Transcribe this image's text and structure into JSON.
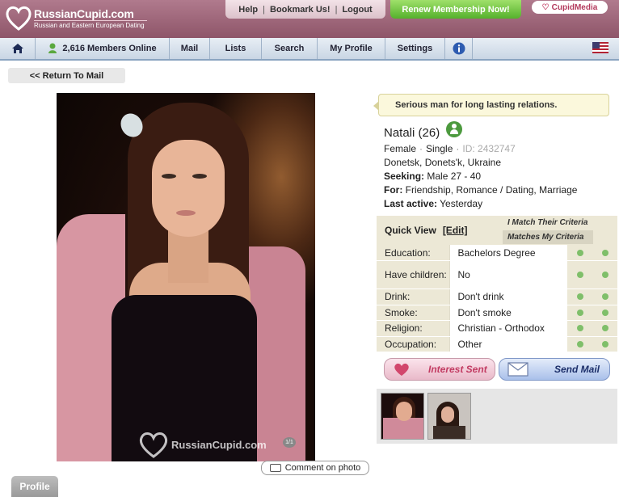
{
  "header": {
    "brand_name": "RussianCupid.com",
    "brand_tagline": "Russian and Eastern European Dating",
    "links": [
      "Help",
      "Bookmark Us!",
      "Logout"
    ],
    "renew_label": "Renew Membership Now!",
    "cupidmedia_label": "CupidMedia",
    "brand_color": "#9a6276",
    "renew_color": "#6cc03a"
  },
  "nav": {
    "members_online": "2,616 Members Online",
    "mail": "Mail",
    "lists": "Lists",
    "search": "Search",
    "my_profile": "My Profile",
    "settings": "Settings"
  },
  "return_label": "<< Return To Mail",
  "photo": {
    "watermark": "RussianCupid.com",
    "count": "1/1"
  },
  "comment_label": "Comment on photo",
  "profile_tab": "Profile",
  "profile": {
    "headline": "Serious man for long lasting relations.",
    "name": "Natali (26)",
    "gender": "Female",
    "status": "Single",
    "id": "ID: 2432747",
    "location": "Donetsk, Donets'k, Ukraine",
    "seeking_label": "Seeking:",
    "seeking": "Male 27 - 40",
    "for_label": "For:",
    "for": "Friendship, Romance / Dating, Marriage",
    "last_active_label": "Last active:",
    "last_active": "Yesterday"
  },
  "quick_view": {
    "title": "Quick View",
    "edit": "[Edit]",
    "criteria1": "I Match Their Criteria",
    "criteria2": "Matches My Criteria",
    "rows": [
      {
        "label": "Education:",
        "value": "Bachelors Degree"
      },
      {
        "label": "Have children:",
        "value": "No"
      },
      {
        "label": "Drink:",
        "value": "Don't drink"
      },
      {
        "label": "Smoke:",
        "value": "Don't smoke"
      },
      {
        "label": "Religion:",
        "value": "Christian - Orthodox"
      },
      {
        "label": "Occupation:",
        "value": "Other"
      }
    ]
  },
  "actions": {
    "interest": "Interest Sent",
    "mail": "Send Mail"
  }
}
